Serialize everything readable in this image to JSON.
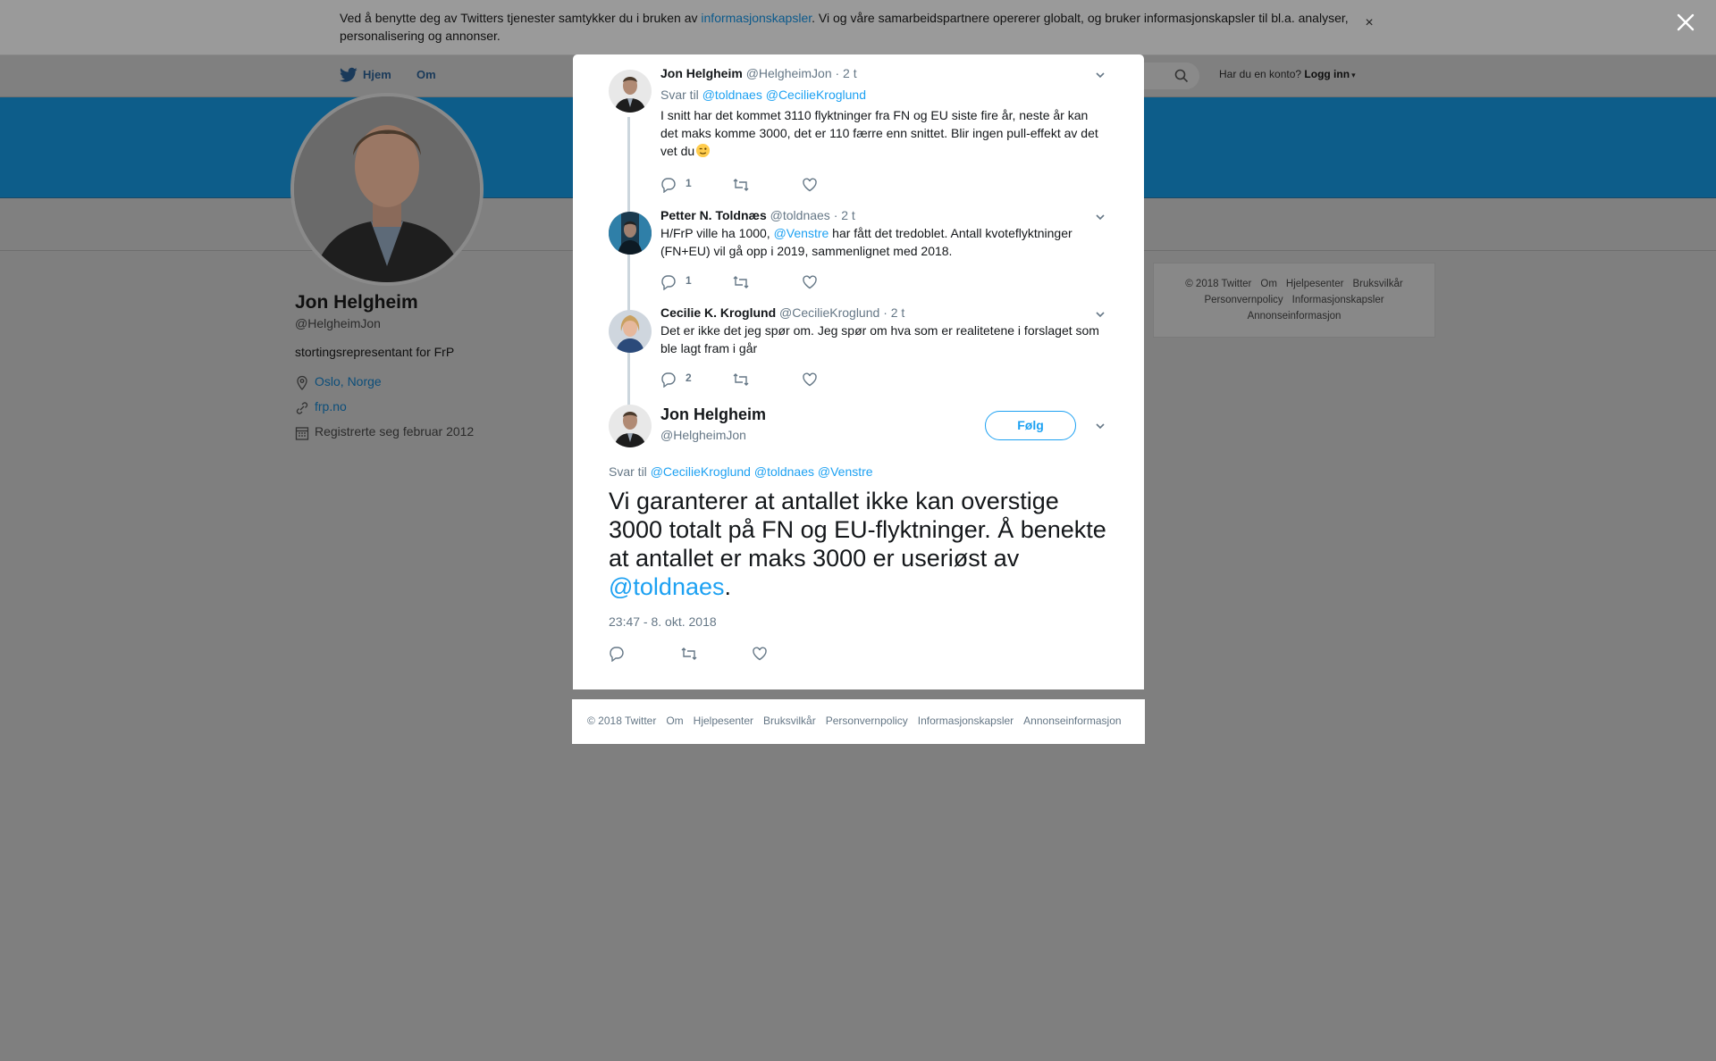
{
  "cookie_banner": {
    "text_before": "Ved å benytte deg av Twitters tjenester samtykker du i bruken av ",
    "link": "informasjonskapsler",
    "text_after": ". Vi og våre samarbeidspartnere opererer globalt, og bruker informasjonskapsler til bl.a. analyser, personalisering og annonser.",
    "close": "×"
  },
  "nav": {
    "home": "Hjem",
    "about": "Om",
    "account_prompt": "Har du en konto?",
    "login": "Logg inn"
  },
  "profile": {
    "name": "Jon Helgheim",
    "handle": "@HelgheimJon",
    "bio": "stortingsrepresentant for FrP",
    "location": "Oslo, Norge",
    "website": "frp.no",
    "joined": "Registrerte seg februar 2012"
  },
  "side_footer": {
    "items": [
      "© 2018 Twitter",
      "Om",
      "Hjelpesenter",
      "Bruksvilkår",
      "Personvernpolicy",
      "Informasjonskapsler",
      "Annonseinformasjon"
    ]
  },
  "thread": [
    {
      "name": "Jon Helgheim",
      "handle": "@HelgheimJon",
      "time": "· 2 t",
      "reply_label": "Svar til",
      "reply_to": [
        "@toldnaes",
        "@CecilieKroglund"
      ],
      "text": "I snitt har det kommet 3110 flyktninger fra FN og EU siste fire år, neste år kan det maks komme 3000, det er 110 færre enn snittet. Blir ingen pull-effekt av det vet du",
      "emoji": "wink",
      "replies": "1"
    },
    {
      "name": "Petter N. Toldnæs",
      "handle": "@toldnaes",
      "time": "· 2 t",
      "text_before": "H/FrP ville ha 1000, ",
      "mention": "@Venstre",
      "text_after": " har fått det tredoblet. Antall kvoteflyktninger (FN+EU) vil gå opp i 2019, sammenlignet med 2018.",
      "replies": "1"
    },
    {
      "name": "Cecilie K. Kroglund",
      "handle": "@CecilieKroglund",
      "time": "· 2 t",
      "text": "Det er ikke det jeg spør om. Jeg spør om hva som er realitetene i forslaget som ble lagt fram i går",
      "replies": "2"
    }
  ],
  "main_tweet": {
    "name": "Jon Helgheim",
    "handle": "@HelgheimJon",
    "follow": "Følg",
    "reply_label": "Svar til",
    "reply_to": [
      "@CecilieKroglund",
      "@toldnaes",
      "@Venstre"
    ],
    "text": "Vi garanterer at antallet ikke kan overstige 3000 totalt på FN og EU-flyktninger. Å benekte at antallet er maks 3000 er useriøst av ",
    "mention": "@toldnaes",
    "text_end": ".",
    "timestamp": "23:47 - 8. okt. 2018"
  },
  "modal_footer": {
    "items": [
      "© 2018 Twitter",
      "Om",
      "Hjelpesenter",
      "Bruksvilkår",
      "Personvernpolicy",
      "Informasjonskapsler",
      "Annonseinformasjon"
    ]
  },
  "colors": {
    "accent": "#1da1f2",
    "text": "#14171a",
    "secondary": "#657786",
    "overlay": "#7f7f7f",
    "banner": "#0d5d8a"
  },
  "icons": [
    "twitter-bird-icon",
    "search-icon",
    "location-icon",
    "link-icon",
    "calendar-icon",
    "chevron-down-icon",
    "reply-icon",
    "retweet-icon",
    "like-icon",
    "close-icon"
  ]
}
